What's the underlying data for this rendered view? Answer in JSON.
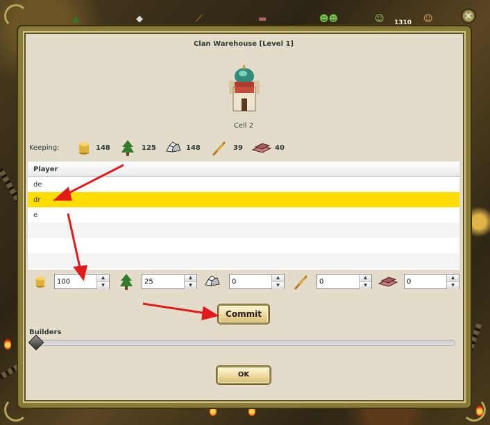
{
  "window": {
    "title": "Clan Warehouse [Level 1]",
    "close_label": "✕"
  },
  "topbar": {
    "count": "1310"
  },
  "building": {
    "cell": "Cell 2"
  },
  "keeping": {
    "label": "Keeping:",
    "items": [
      {
        "icon": "gold-icon",
        "value": "148"
      },
      {
        "icon": "wood-icon",
        "value": "125"
      },
      {
        "icon": "stone-icon",
        "value": "148"
      },
      {
        "icon": "grain-icon",
        "value": "39"
      },
      {
        "icon": "iron-icon",
        "value": "40"
      }
    ]
  },
  "players": {
    "header": "Player",
    "rows": [
      "de",
      "dr",
      "e"
    ],
    "selected": "dr"
  },
  "transfer": {
    "gold": "100",
    "wood": "25",
    "stone": "0",
    "grain": "0",
    "iron": "0"
  },
  "buttons": {
    "commit": "Commit",
    "ok": "OK"
  },
  "builders": {
    "label": "Builders",
    "level": 0
  },
  "colors": {
    "highlight": "#ffdd00",
    "annotation_arrow": "#e21a1a",
    "panel": "#e4dccb"
  }
}
